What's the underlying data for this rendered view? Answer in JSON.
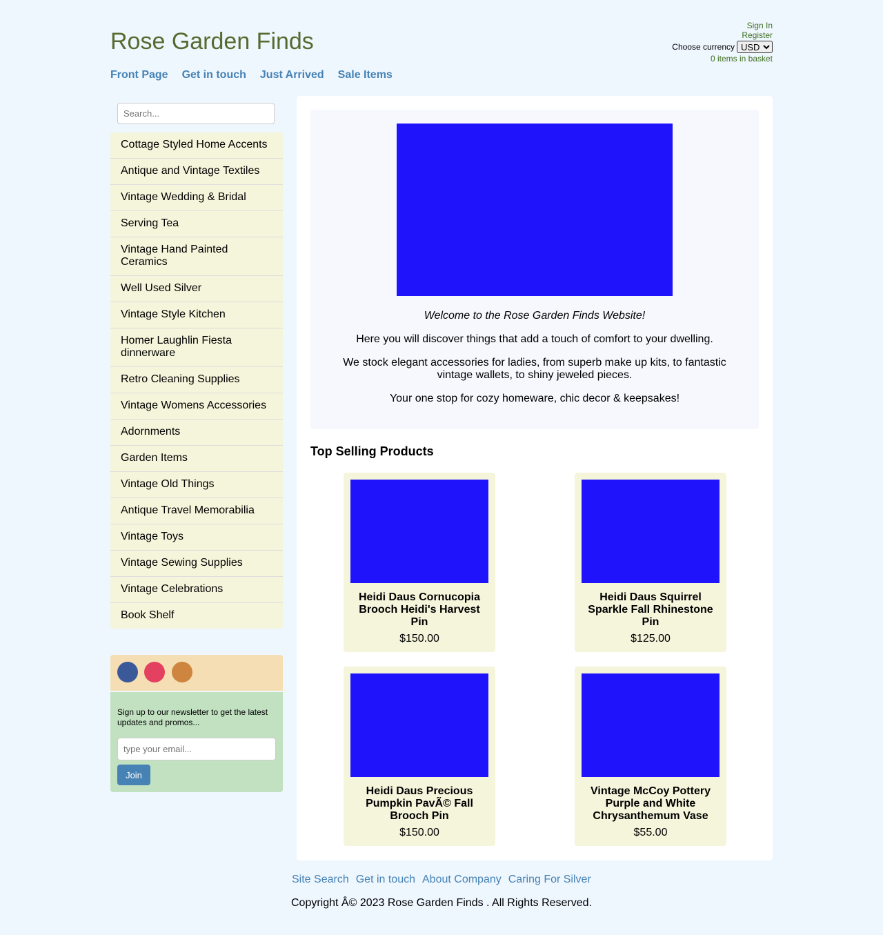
{
  "header": {
    "title": "Rose Garden Finds",
    "sign_in": "Sign In",
    "register": "Register",
    "currency_label": "Choose currency",
    "currency_value": "USD",
    "basket": "0 items in basket"
  },
  "nav": [
    "Front Page",
    "Get in touch",
    "Just Arrived",
    "Sale Items"
  ],
  "sidebar": {
    "search_placeholder": "Search...",
    "categories": [
      "Cottage Styled Home Accents",
      "Antique and Vintage Textiles",
      "Vintage Wedding & Bridal",
      "Serving Tea",
      "Vintage Hand Painted Ceramics",
      "Well Used Silver",
      "Vintage Style Kitchen",
      "Homer Laughlin Fiesta dinnerware",
      "Retro Cleaning Supplies",
      "Vintage Womens Accessories",
      "Adornments",
      "Garden Items",
      "Vintage Old Things",
      "Antique Travel Memorabilia",
      "Vintage Toys",
      "Vintage Sewing Supplies",
      "Vintage Celebrations",
      "Book Shelf"
    ],
    "social_colors": [
      "#3b5998",
      "#e4405f",
      "#cd853f"
    ],
    "newsletter": {
      "text": "Sign up to our newsletter to get the latest updates and promos...",
      "email_placeholder": "type your email...",
      "join_label": "Join"
    }
  },
  "welcome": {
    "heading": "Welcome to the Rose Garden Finds Website!",
    "p1": "Here you will discover things that add a touch of comfort to your dwelling.",
    "p2": "We stock elegant accessories for ladies, from superb make up kits, to fantastic vintage wallets, to shiny jeweled pieces.",
    "p3": "Your one stop for cozy homeware, chic decor & keepsakes!"
  },
  "top_selling": {
    "title": "Top Selling Products",
    "products": [
      {
        "name": "Heidi Daus Cornucopia Brooch Heidi's Harvest Pin",
        "price": "$150.00"
      },
      {
        "name": "Heidi Daus Squirrel Sparkle Fall Rhinestone Pin",
        "price": "$125.00"
      },
      {
        "name": "Heidi Daus Precious Pumpkin PavÃ© Fall Brooch Pin",
        "price": "$150.00"
      },
      {
        "name": "Vintage McCoy Pottery Purple and White Chrysanthemum Vase",
        "price": "$55.00"
      }
    ]
  },
  "footer": {
    "links": [
      "Site Search",
      "Get in touch",
      "About Company",
      "Caring For Silver"
    ],
    "copyright": "Copyright Â© 2023 Rose Garden Finds . All Rights Reserved."
  },
  "colors": {
    "background": "#eef6fe",
    "title_green": "#556b2f",
    "link_blue": "#4682b4",
    "beige": "#f5f5dc",
    "product_image": "#1f13fb"
  }
}
